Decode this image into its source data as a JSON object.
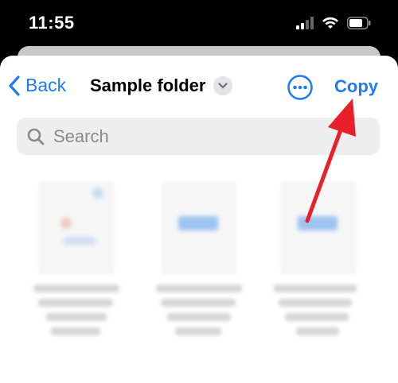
{
  "status_bar": {
    "time": "11:55",
    "icons": [
      "signal-icon",
      "wifi-icon",
      "battery-icon"
    ]
  },
  "nav": {
    "back_label": "Back",
    "title": "Sample folder",
    "copy_label": "Copy",
    "icons": [
      "chevron-left-icon",
      "chevron-down-icon",
      "more-icon"
    ]
  },
  "search": {
    "placeholder": "Search"
  },
  "colors": {
    "accent": "#1e7cf5",
    "annotation_arrow": "#e8202a"
  }
}
